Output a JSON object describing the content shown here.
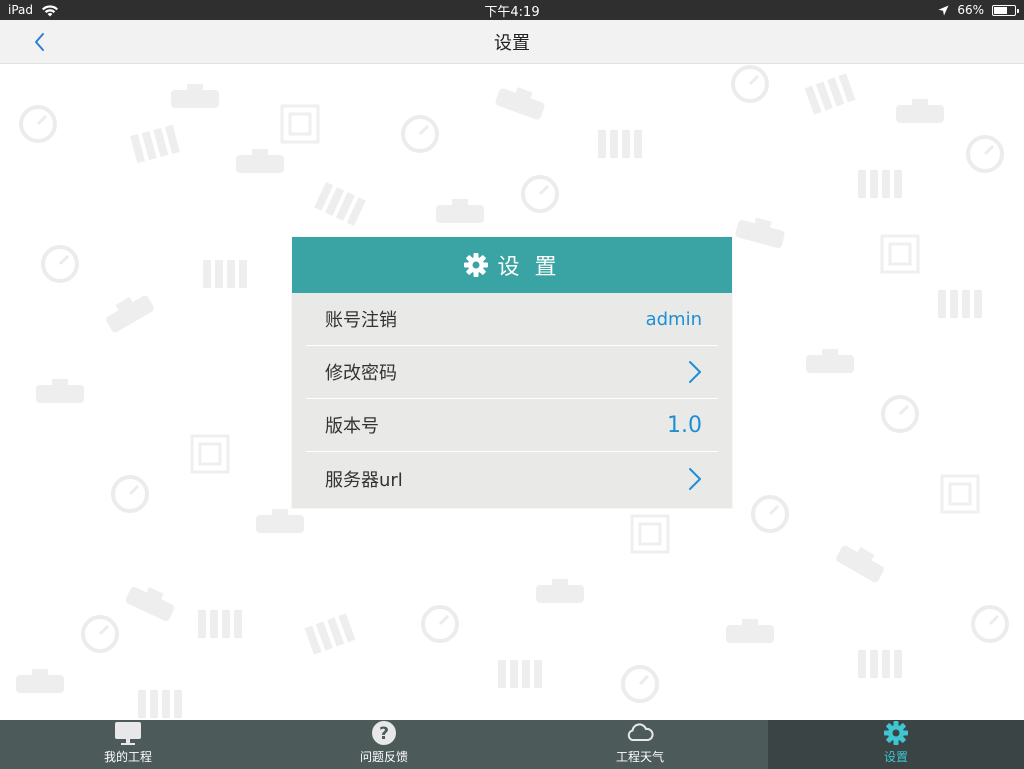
{
  "status_bar": {
    "carrier": "iPad",
    "time": "下午4:19",
    "battery": "66%",
    "battery_level": 0.66
  },
  "nav": {
    "title": "设置",
    "back_icon": "chevron-left-icon"
  },
  "panel": {
    "title": "设 置",
    "header_icon": "gear-icon",
    "accent_color": "#3aa3a3",
    "rows": [
      {
        "label": "账号注销",
        "value": "admin"
      },
      {
        "label": "修改密码",
        "value": ""
      },
      {
        "label": "版本号",
        "value": "1.0"
      },
      {
        "label": "服务器url",
        "value": ""
      }
    ]
  },
  "tab_bar": {
    "tabs": [
      {
        "label": "我的工程",
        "icon": "monitor-icon"
      },
      {
        "label": "问题反馈",
        "icon": "question-icon"
      },
      {
        "label": "工程天气",
        "icon": "cloud-icon"
      },
      {
        "label": "设置",
        "icon": "gear-icon"
      }
    ],
    "active_color": "#3ec6d2"
  }
}
